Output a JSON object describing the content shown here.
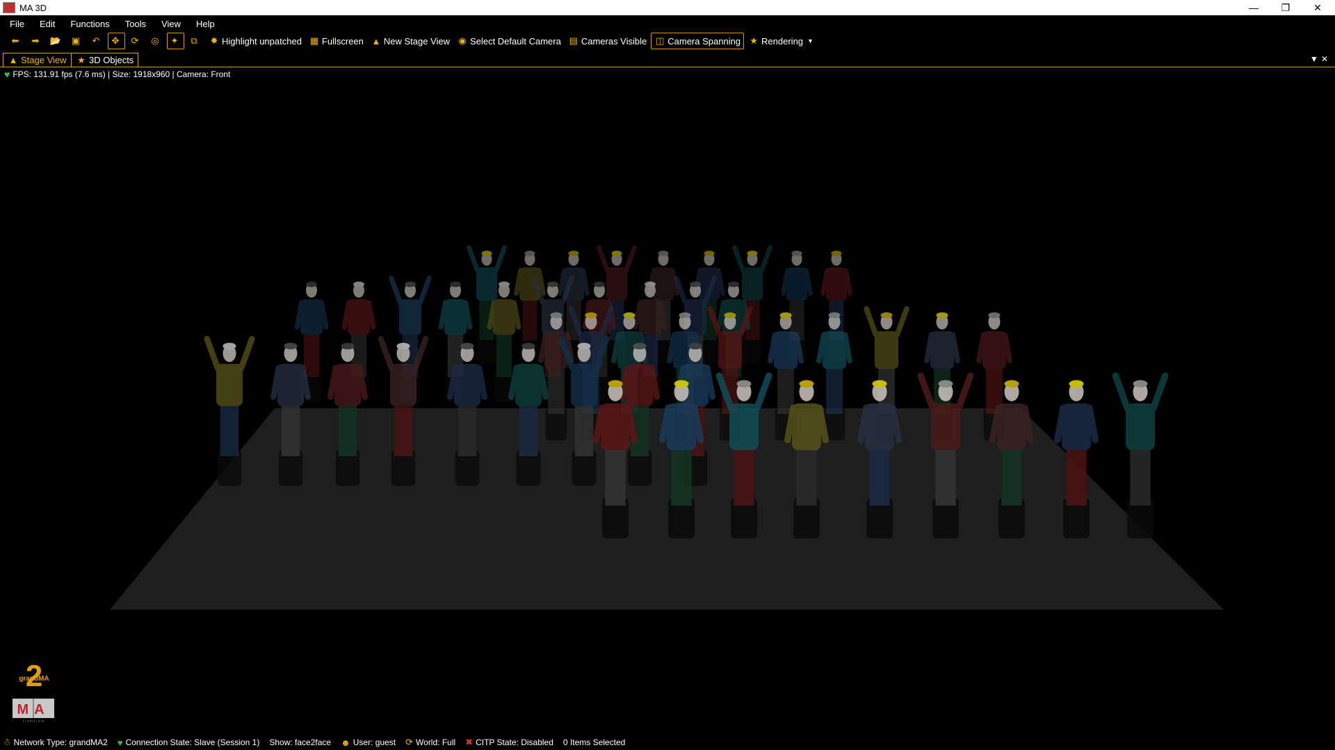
{
  "window": {
    "title": "MA 3D"
  },
  "menu": [
    "File",
    "Edit",
    "Functions",
    "Tools",
    "View",
    "Help"
  ],
  "toolbar": {
    "highlight_unpatched": "Highlight unpatched",
    "fullscreen": "Fullscreen",
    "new_stage_view": "New Stage View",
    "select_default_camera": "Select Default Camera",
    "cameras_visible": "Cameras Visible",
    "camera_spanning": "Camera Spanning",
    "rendering": "Rendering"
  },
  "tabs": {
    "stage_view": "Stage View",
    "objects_3d": "3D Objects"
  },
  "viewport": {
    "info": "FPS: 131.91 fps (7.6 ms) | Size: 1918x960 | Camera: Front"
  },
  "logo": {
    "text_top": "grandMA",
    "text_bottom": "MA",
    "digit": "2",
    "sub": "lighting"
  },
  "status": {
    "network": "Network Type: grandMA2",
    "connection": "Connection State: Slave (Session 1)",
    "show": "Show: face2face",
    "user": "User: guest",
    "world": "World: Full",
    "citp": "CITP State: Disabled",
    "selection": "0 Items Selected"
  },
  "colors": {
    "accent": "#f0b400",
    "background": "#000000",
    "stage": "#1e1e1e"
  }
}
